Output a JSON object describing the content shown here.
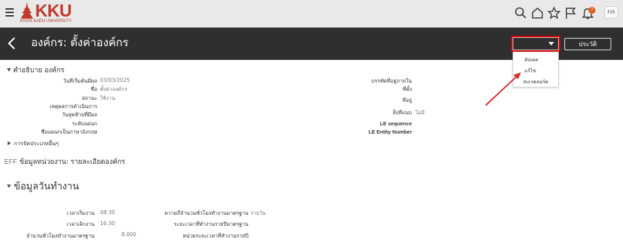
{
  "colors": {
    "topbar_bg": "#e9e9e9",
    "header_bg": "#2f2f2f",
    "brand": "#c0392b",
    "highlight": "#e00000",
    "badge": "#e05a1c"
  },
  "topbar": {
    "logo_text": "KKU",
    "logo_subtitle": "KHON KAEN UNIVERSITY",
    "icons": [
      "search-icon",
      "home-icon",
      "star-icon",
      "flag-icon",
      "bell-icon"
    ],
    "notification_count": "7",
    "avatar_initials": "HA"
  },
  "header": {
    "title": "องค์กร: ตั้งค่าองค์กร",
    "edit_button": "แก้ไข",
    "history_button": "ประวัติ",
    "menu": [
      "อัปเดต",
      "แก้ไข",
      "ลบเรคคอร์ด"
    ]
  },
  "description": {
    "title": "คำอธิบาย องค์กร",
    "left_fields": [
      {
        "label": "วันที่เริ่มต้นมีผล",
        "value": "03/03/2025"
      },
      {
        "label": "ชื่อ",
        "value": "ตั้งค่าองค์กร"
      },
      {
        "label": "สถานะ",
        "value": "ใช้งาน"
      },
      {
        "label": "เหตุผลการดำเนินการ",
        "value": ""
      },
      {
        "label": "วันสุดท้ายที่มีผล",
        "value": ""
      },
      {
        "label": "ระดับแผนก",
        "value": ""
      },
      {
        "label": "ชื่อแผนกเป็นภาษาอังกฤษ",
        "value": ""
      }
    ],
    "right_fields": [
      {
        "label": "บรรทัดที่อยู่ภายใน",
        "value": ""
      },
      {
        "label": "ที่ตั้ง",
        "value": ""
      },
      {
        "label": "ที่อยู่",
        "value": ""
      },
      {
        "label": "สิ่งที่แนบ",
        "value": "ไม่มี"
      },
      {
        "label": "LE sequence",
        "value": ""
      },
      {
        "label": "LE Entity Number",
        "value": ""
      }
    ],
    "other_classifications": "การจัดประเภทอื่นๆ"
  },
  "eff": {
    "prefix": "EFF",
    "title": "ข้อมูลหน่วยงาน: รายละเอียดองค์กร"
  },
  "workday": {
    "title": "ข้อมูลวันทำงาน",
    "left_fields": [
      {
        "label": "เวลาเริ่มงาน",
        "value": "08:30"
      },
      {
        "label": "เวลาเลิกงาน",
        "value": "16:30"
      },
      {
        "label": "จำนวนชั่วโมงทำงานมาตรฐาน",
        "value": "8.000"
      }
    ],
    "right_fields": [
      {
        "label": "ความถี่จำนวนชั่วโมงทำงานมาตรฐาน",
        "value": "รายวัน"
      },
      {
        "label": "ระยะเวลาที่ทำงานรายปีมาตรฐาน",
        "value": ""
      },
      {
        "label": "หน่วยระยะเวลาที่ทำงานรายปี",
        "value": ""
      }
    ]
  }
}
